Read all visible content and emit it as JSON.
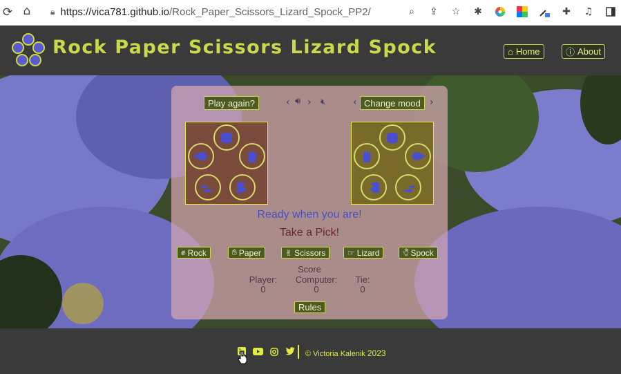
{
  "browser": {
    "url_host": "https://vica781.github.io",
    "url_path": "/Rock_Paper_Scissors_Lizard_Spock_PP2/",
    "nav_icons": [
      "reload-icon",
      "home-icon"
    ],
    "tool_icons": [
      "zoom-icon",
      "share-icon",
      "star-icon",
      "extension-bug-icon",
      "color-wheel-icon",
      "color-grid-icon",
      "eyedropper-icon",
      "puzzle-icon",
      "media-icon",
      "sidepanel-icon"
    ]
  },
  "header": {
    "title": "Rock Paper Scissors Lizard Spock",
    "home_label": "Home",
    "about_label": "About"
  },
  "game": {
    "play_again_label": "Play again?",
    "change_mood_label": "Change mood",
    "status_ready": "Ready when you are!",
    "status_pick": "Take a Pick!",
    "choices": [
      "Rock",
      "Paper",
      "Scissors",
      "Lizard",
      "Spock"
    ],
    "score": {
      "title": "Score",
      "player_label": "Player:",
      "player_value": "0",
      "computer_label": "Computer:",
      "computer_value": "0",
      "tie_label": "Tie:",
      "tie_value": "0"
    },
    "rules_label": "Rules"
  },
  "footer": {
    "social": [
      "linkedin-icon",
      "youtube-icon",
      "instagram-icon",
      "twitter-icon"
    ],
    "credit_name": "© Victoria Kalenik",
    "credit_year": "2023"
  },
  "colors": {
    "accent": "#c9d94a",
    "header_bg": "#3b3a3a",
    "panel_bg": "#d6a8b1",
    "status_blue": "#4a4fc8",
    "status_brown": "#6a2a2a"
  }
}
